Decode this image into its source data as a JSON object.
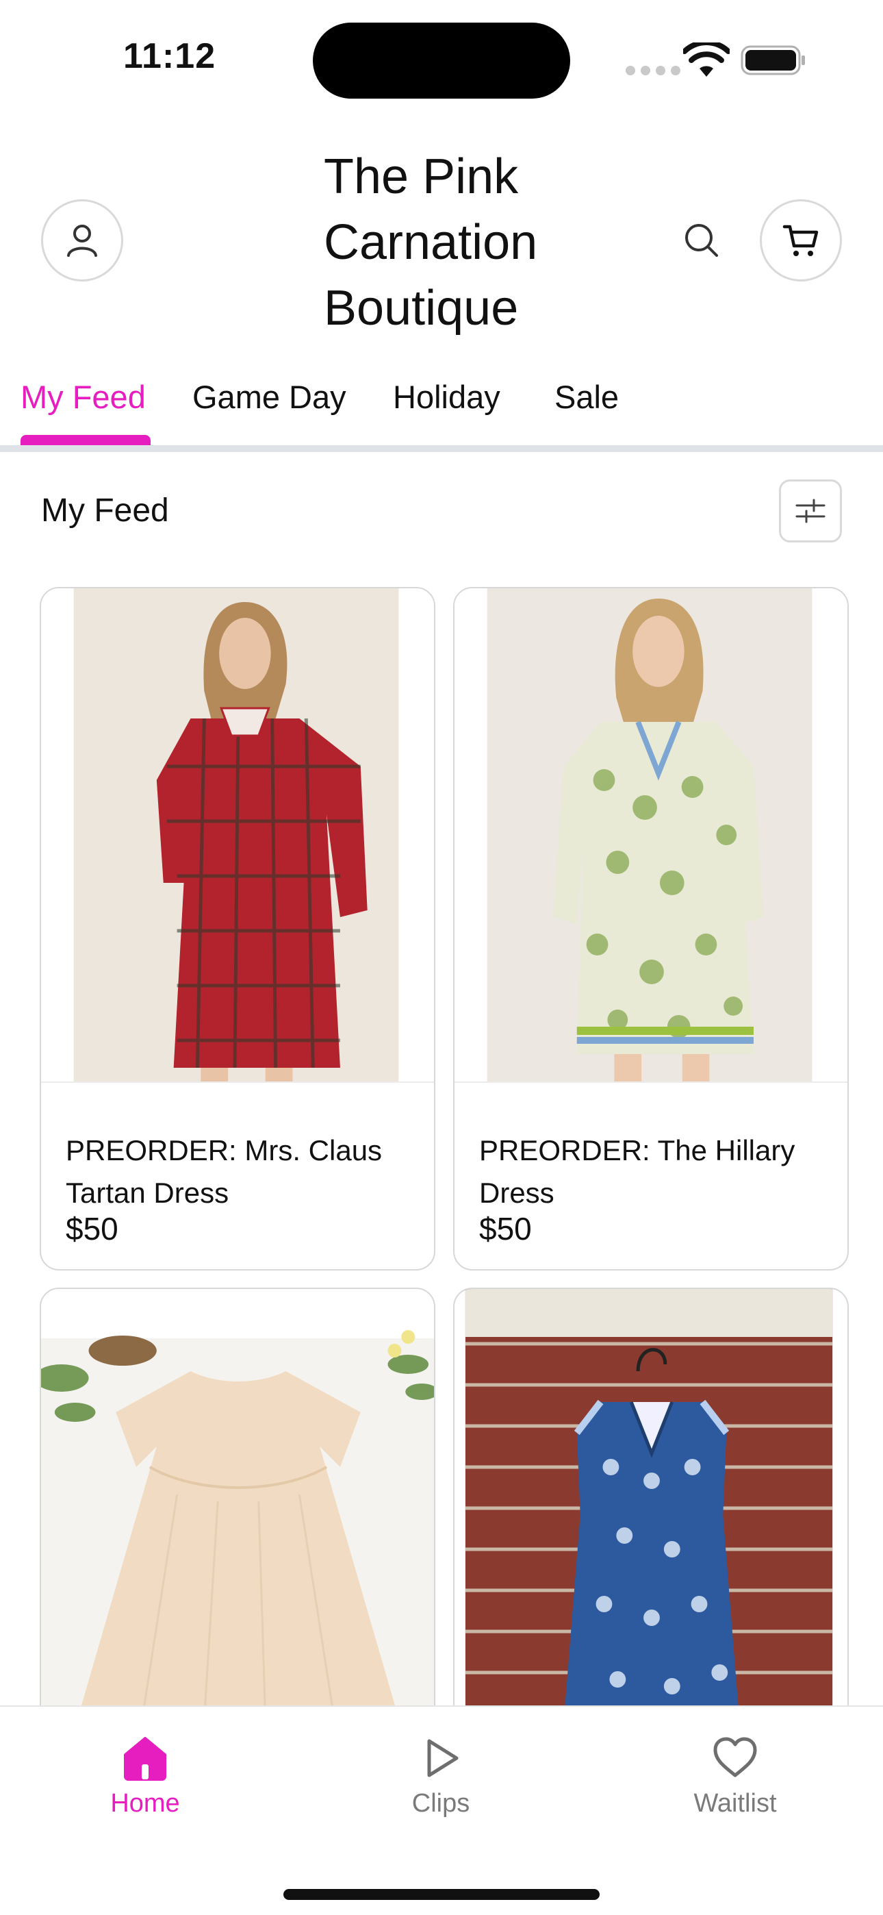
{
  "status_bar": {
    "time": "11:12"
  },
  "header": {
    "store_name": "The Pink Carnation Boutique"
  },
  "tabs": [
    {
      "label": "My Feed",
      "active": true
    },
    {
      "label": "Game Day",
      "active": false
    },
    {
      "label": "Holiday",
      "active": false
    },
    {
      "label": "Sale",
      "active": false
    }
  ],
  "section": {
    "title": "My Feed"
  },
  "products": [
    {
      "name": "PREORDER: Mrs. Claus Tartan Dress",
      "price": "$50"
    },
    {
      "name": "PREORDER: The Hillary Dress",
      "price": "$50"
    }
  ],
  "bottom_nav": [
    {
      "label": "Home",
      "icon": "home-icon",
      "active": true
    },
    {
      "label": "Clips",
      "icon": "play-icon",
      "active": false
    },
    {
      "label": "Waitlist",
      "icon": "heart-icon",
      "active": false
    }
  ],
  "colors": {
    "accent": "#e61ec0",
    "inactive": "#7a7a7a",
    "border": "#d7d7d7"
  }
}
